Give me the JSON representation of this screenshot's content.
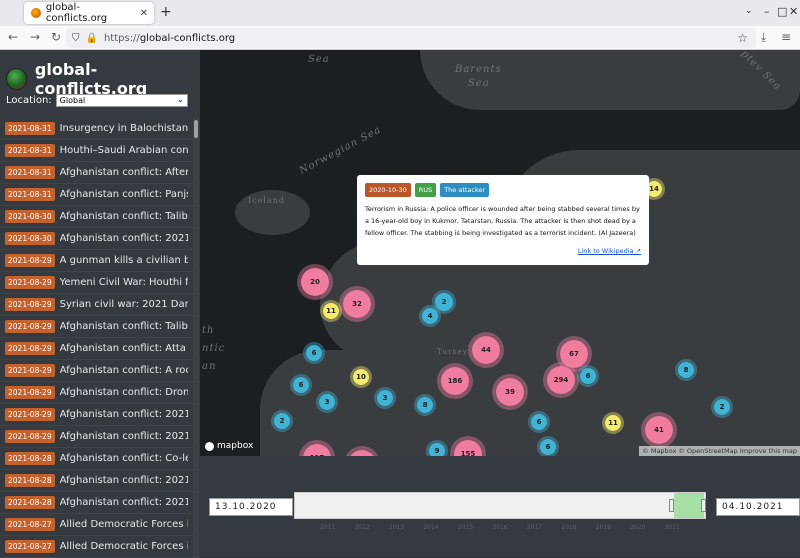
{
  "browser": {
    "tab_title": "global-conflicts.org",
    "url_protocol": "https://",
    "url_host": "global-conflicts.org"
  },
  "sidebar": {
    "brand": "global-conflicts.org",
    "location_label": "Location:",
    "location_value": "Global",
    "events": [
      {
        "date": "2021-08-31",
        "title": "Insurgency in Balochistan, ..."
      },
      {
        "date": "2021-08-31",
        "title": "Houthi–Saudi Arabian confl..."
      },
      {
        "date": "2021-08-31",
        "title": "Afghanistan conflict: After..."
      },
      {
        "date": "2021-08-31",
        "title": "Afghanistan conflict: Panjs..."
      },
      {
        "date": "2021-08-30",
        "title": "Afghanistan conflict: Taliba..."
      },
      {
        "date": "2021-08-30",
        "title": "Afghanistan conflict: 2021 ..."
      },
      {
        "date": "2021-08-29",
        "title": "A gunman kills a civilian b..."
      },
      {
        "date": "2021-08-29",
        "title": "Yemeni Civil War: Houthi fo..."
      },
      {
        "date": "2021-08-29",
        "title": "Syrian civil war: 2021 Dara..."
      },
      {
        "date": "2021-08-29",
        "title": "Afghanistan conflict: Taliba..."
      },
      {
        "date": "2021-08-29",
        "title": "Afghanistan conflict: Atta ..."
      },
      {
        "date": "2021-08-29",
        "title": "Afghanistan conflict: A roc..."
      },
      {
        "date": "2021-08-29",
        "title": "Afghanistan conflict: Dron..."
      },
      {
        "date": "2021-08-29",
        "title": "Afghanistan conflict: 2021 ..."
      },
      {
        "date": "2021-08-29",
        "title": "Afghanistan conflict: 2021 ..."
      },
      {
        "date": "2021-08-28",
        "title": "Afghanistan conflict: Co-le..."
      },
      {
        "date": "2021-08-28",
        "title": "Afghanistan conflict: 2021 ..."
      },
      {
        "date": "2021-08-28",
        "title": "Afghanistan conflict: 2021 ..."
      },
      {
        "date": "2021-08-27",
        "title": "Allied Democratic Forces i..."
      },
      {
        "date": "2021-08-27",
        "title": "Allied Democratic Forces i..."
      }
    ]
  },
  "map": {
    "labels": {
      "sea": "Sea",
      "barents": "Barents",
      "barents_sea": "Sea",
      "norwegian_sea": "Norwegian Sea",
      "iceland": "Iceland",
      "ptev": "ptev Sea",
      "turkey": "Turkey",
      "th": "th",
      "ntic": "ntic",
      "an": "an"
    },
    "clusters": [
      "14",
      "20",
      "32",
      "11",
      "2",
      "4",
      "6",
      "44",
      "67",
      "6",
      "10",
      "186",
      "294",
      "6",
      "8",
      "3",
      "3",
      "8",
      "39",
      "6",
      "2",
      "6",
      "11",
      "41",
      "2",
      "117",
      "9",
      "155"
    ],
    "popup": {
      "date": "2020-10-30",
      "country": "RUS",
      "actor": "The attacker",
      "description": "Terrorism in Russia: A police officer is wounded after being stabbed several times by a 16-year-old boy in Kukmor, Tatarstan, Russia. The attacker is then shot dead by a fellow officer. The stabbing is being investigated as a terrorist incident. (Al Jazeera)",
      "wiki_link": "Link to Wikipedia ↗"
    },
    "mapbox": "mapbox",
    "attribution": "© Mapbox © OpenStreetMap Improve this map"
  },
  "timeline": {
    "start_date": "13.10.2020",
    "end_date": "04.10.2021",
    "years": [
      "2011",
      "2012",
      "2013",
      "2014",
      "2015",
      "2016",
      "2017",
      "2018",
      "2019",
      "2020",
      "2021"
    ]
  },
  "colors": {
    "sidebar_bg": "#343a40",
    "date_badge": "#c4622d",
    "map_bg": "#1c1f22",
    "cluster_blue": "#41b4d6",
    "cluster_pink": "#f07ca0",
    "cluster_yellow": "#f5ec6e"
  }
}
